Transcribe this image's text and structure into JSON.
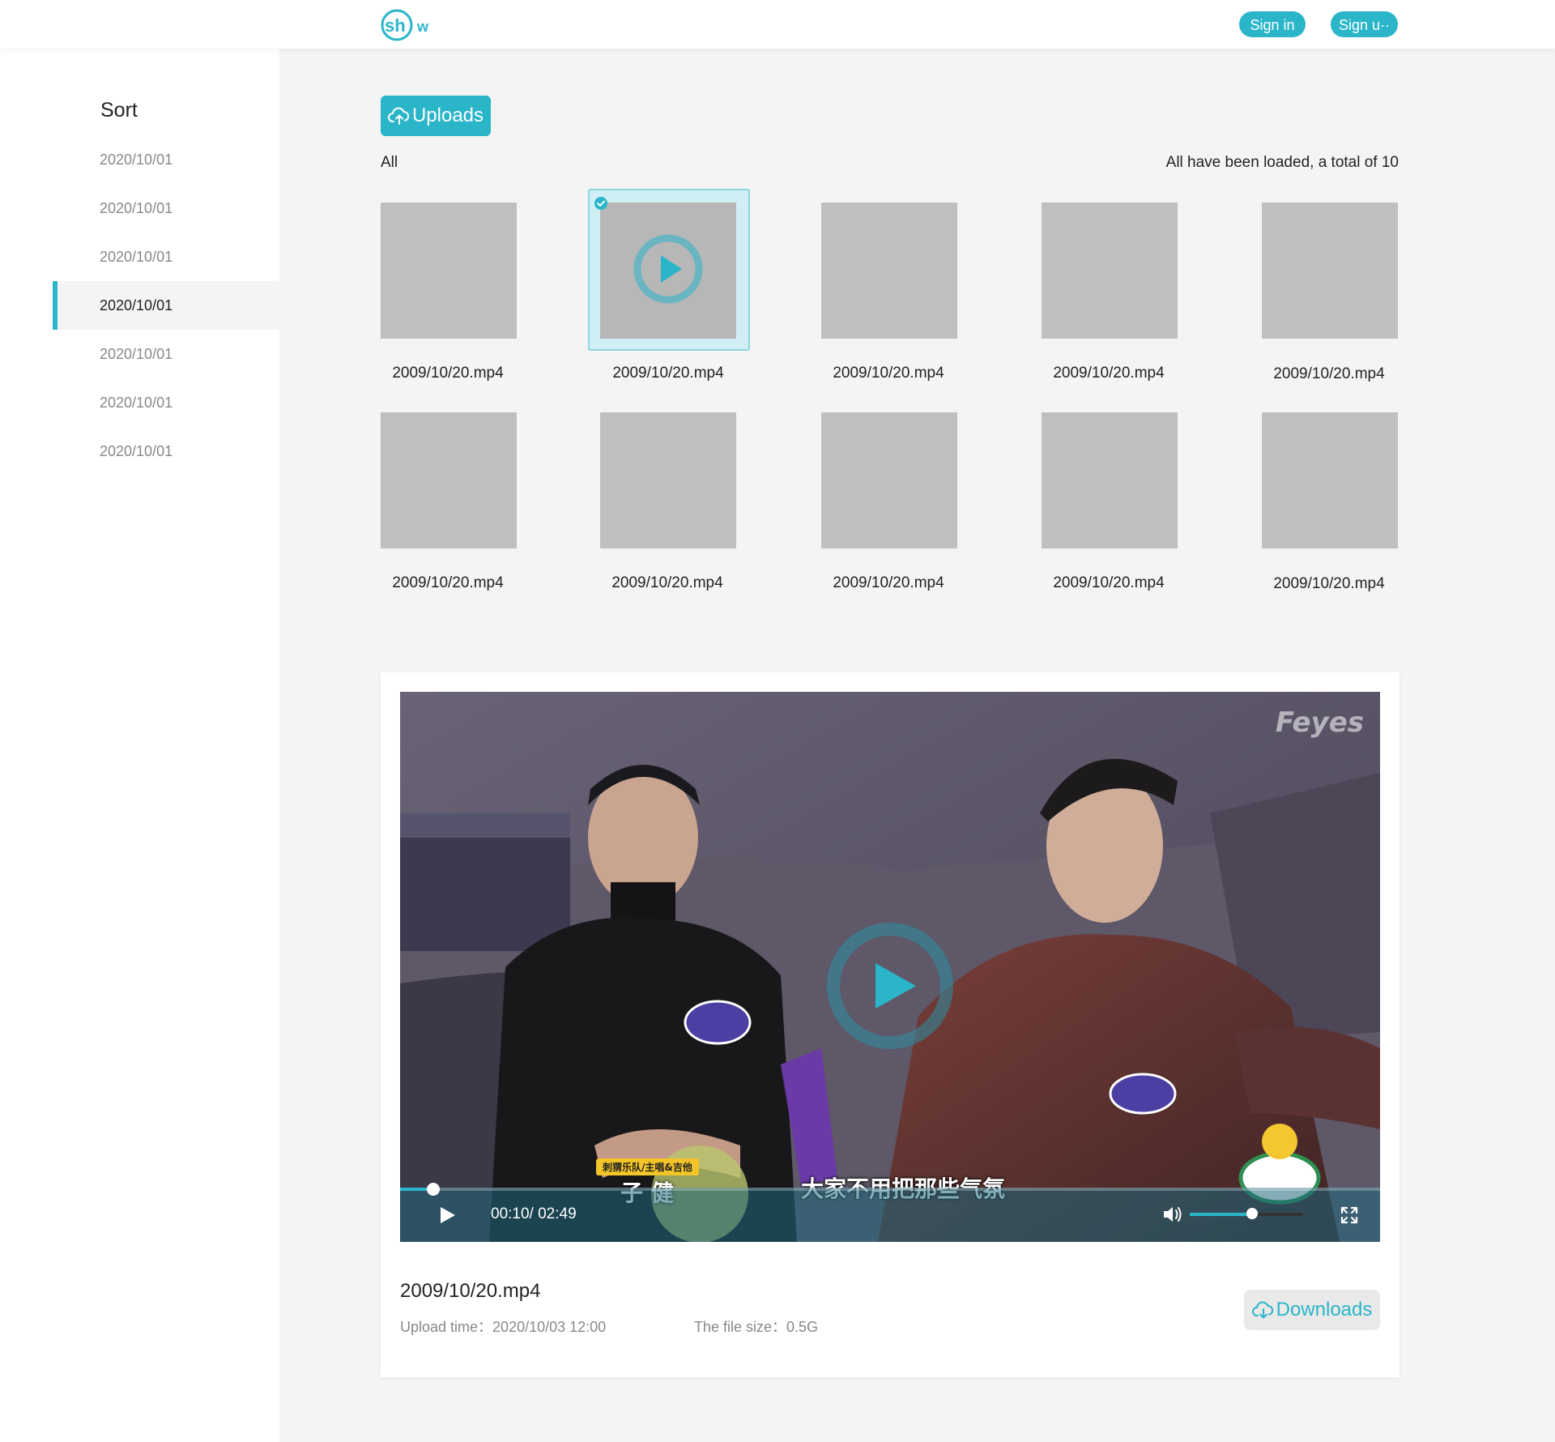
{
  "header": {
    "logo_text": "shw",
    "signin_label": "Sign in",
    "signup_label": "Sign u··"
  },
  "sidebar": {
    "title": "Sort",
    "items": [
      {
        "label": "2020/10/01",
        "active": false
      },
      {
        "label": "2020/10/01",
        "active": false
      },
      {
        "label": "2020/10/01",
        "active": false
      },
      {
        "label": "2020/10/01",
        "active": true
      },
      {
        "label": "2020/10/01",
        "active": false
      },
      {
        "label": "2020/10/01",
        "active": false
      },
      {
        "label": "2020/10/01",
        "active": false
      }
    ]
  },
  "main": {
    "uploads_label": "Uploads",
    "filter_label": "All",
    "status_text": "All have been loaded, a total of 10",
    "files": [
      {
        "name": "2009/10/20.mp4",
        "selected": false
      },
      {
        "name": "2009/10/20.mp4",
        "selected": true
      },
      {
        "name": "2009/10/20.mp4",
        "selected": false
      },
      {
        "name": "2009/10/20.mp4",
        "selected": false
      },
      {
        "name": "2009/10/20.mp4",
        "selected": false
      },
      {
        "name": "2009/10/20.mp4",
        "selected": false
      },
      {
        "name": "2009/10/20.mp4",
        "selected": false
      },
      {
        "name": "2009/10/20.mp4",
        "selected": false
      },
      {
        "name": "2009/10/20.mp4",
        "selected": false
      },
      {
        "name": "2009/10/20.mp4",
        "selected": false
      }
    ]
  },
  "player": {
    "watermark": "Feyes",
    "tag_top": "刺猬乐队/主唱&吉他",
    "tag_name": "子 健",
    "subtitle": "大家不用把那些气氛",
    "time_text": "00:10/ 02:49",
    "progress_fraction": 0.034,
    "volume_fraction": 0.55,
    "file_name": "2009/10/20.mp4",
    "upload_time": "Upload time：2020/10/03 12:00",
    "file_size": "The file size：0.5G",
    "downloads_label": "Downloads"
  },
  "colors": {
    "accent": "#2ab5c9",
    "placeholder": "#bfbfbf",
    "page_bg": "#f4f4f4"
  },
  "icons": [
    "logo-icon",
    "cloud-upload-icon",
    "check-circle-icon",
    "play-circle-icon",
    "play-icon",
    "volume-icon",
    "fullscreen-icon",
    "cloud-download-icon"
  ]
}
